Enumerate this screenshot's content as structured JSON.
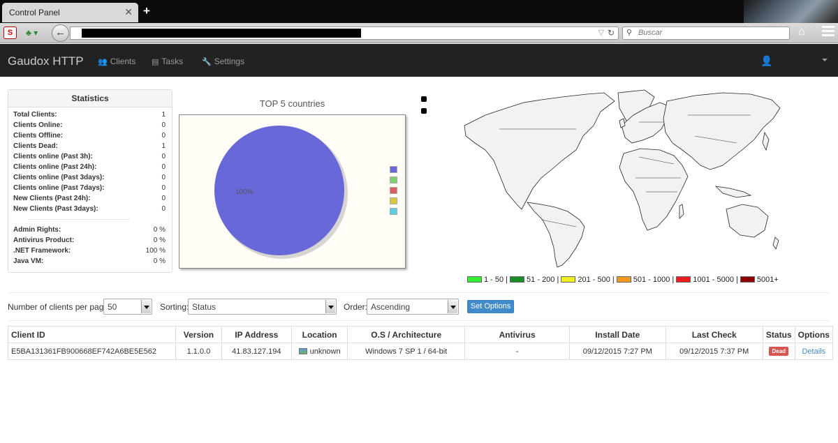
{
  "browser": {
    "tab_title": "Control Panel",
    "search_placeholder": "Buscar"
  },
  "app": {
    "brand": "Gaudox HTTP",
    "nav": [
      {
        "label": "Clients",
        "icon": "users-icon"
      },
      {
        "label": "Tasks",
        "icon": "list-icon"
      },
      {
        "label": "Settings",
        "icon": "wrench-icon"
      }
    ]
  },
  "statistics": {
    "title": "Statistics",
    "rows": [
      {
        "label": "Total Clients:",
        "value": "1"
      },
      {
        "label": "Clients Online:",
        "value": "0"
      },
      {
        "label": "Clients Offline:",
        "value": "0"
      },
      {
        "label": "Clients Dead:",
        "value": "1"
      },
      {
        "label": "Clients online (Past 3h):",
        "value": "0"
      },
      {
        "label": "Clients online (Past 24h):",
        "value": "0"
      },
      {
        "label": "Clients online (Past 3days):",
        "value": "0"
      },
      {
        "label": "Clients online (Past 7days):",
        "value": "0"
      },
      {
        "label": "New Clients (Past 24h):",
        "value": "0"
      },
      {
        "label": "New Clients (Past 3days):",
        "value": "0"
      }
    ],
    "rows2": [
      {
        "label": "Admin Rights:",
        "value": "0 %"
      },
      {
        "label": "Antivirus Product:",
        "value": "0 %"
      },
      {
        "label": ".NET Framework:",
        "value": "100 %"
      },
      {
        "label": "Java VM:",
        "value": "0 %"
      }
    ]
  },
  "chart_data": {
    "type": "pie",
    "title": "TOP 5 countries",
    "slices": [
      {
        "label": "",
        "value": 100,
        "display": "100%",
        "color": "#6868d8"
      }
    ],
    "legend_colors": [
      "#6868d8",
      "#7fcf6f",
      "#d96060",
      "#d8c848",
      "#5ccce0"
    ]
  },
  "map_legend": [
    {
      "label": "1 - 50 |",
      "color": "#33ee33"
    },
    {
      "label": "51 - 200 |",
      "color": "#1a8a2a"
    },
    {
      "label": "201 - 500 |",
      "color": "#f0f020"
    },
    {
      "label": "501 - 1000 |",
      "color": "#f09a20"
    },
    {
      "label": "1001 - 5000 |",
      "color": "#ee1c1c"
    },
    {
      "label": "5001+",
      "color": "#8a0000"
    }
  ],
  "controls": {
    "per_page_label": "Number of clients per page:",
    "per_page_value": "50",
    "sorting_label": "Sorting:",
    "sorting_value": "Status",
    "order_label": "Order:",
    "order_value": "Ascending",
    "set_options": "Set Options"
  },
  "table": {
    "headers": [
      "Client ID",
      "Version",
      "IP Address",
      "Location",
      "O.S / Architecture",
      "Antivirus",
      "Install Date",
      "Last Check",
      "Status",
      "Options"
    ],
    "rows": [
      {
        "client_id": "E5BA131361FB900668EF742A6BE5E562",
        "version": "1.1.0.0",
        "ip": "41.83.127.194",
        "location": "unknown",
        "os": "Windows 7 SP 1 / 64-bit",
        "antivirus": "-",
        "install_date": "09/12/2015 7:27 PM",
        "last_check": "09/12/2015 7:37 PM",
        "status": "Dead",
        "options": "Details"
      }
    ]
  }
}
